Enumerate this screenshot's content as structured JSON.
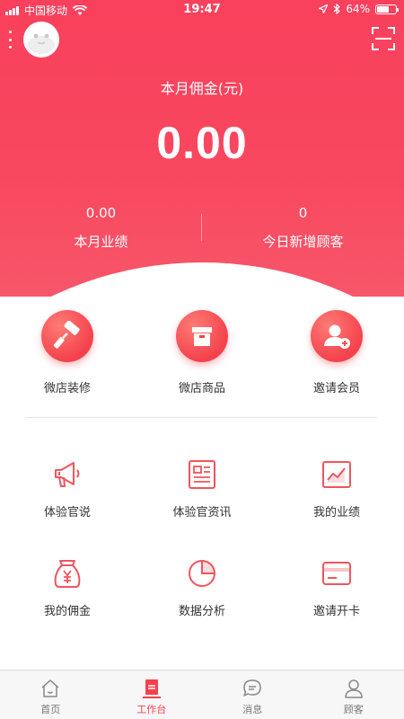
{
  "status_bar": {
    "carrier": "中国移动",
    "time": "19:47",
    "battery": "64%",
    "battery_level": 0.64
  },
  "header": {
    "commission_label": "本月佣金(元)",
    "commission_value": "0.00",
    "stats": [
      {
        "value": "0.00",
        "label": "本月业绩"
      },
      {
        "value": "0",
        "label": "今日新增顾客"
      }
    ]
  },
  "quick_actions": [
    {
      "label": "微店装修",
      "icon": "paint-roller-icon"
    },
    {
      "label": "微店商品",
      "icon": "box-icon"
    },
    {
      "label": "邀请会员",
      "icon": "add-user-icon"
    }
  ],
  "tools": [
    {
      "label": "体验官说",
      "icon": "megaphone-icon"
    },
    {
      "label": "体验官资讯",
      "icon": "news-icon"
    },
    {
      "label": "我的业绩",
      "icon": "trend-chart-icon"
    },
    {
      "label": "我的佣金",
      "icon": "money-bag-icon"
    },
    {
      "label": "数据分析",
      "icon": "pie-chart-icon"
    },
    {
      "label": "邀请开卡",
      "icon": "card-icon"
    }
  ],
  "tabbar": {
    "tabs": [
      {
        "label": "首页",
        "icon": "home-icon",
        "active": false
      },
      {
        "label": "工作台",
        "icon": "workbench-icon",
        "active": true
      },
      {
        "label": "消息",
        "icon": "message-icon",
        "active": false
      },
      {
        "label": "顾客",
        "icon": "customer-icon",
        "active": false
      }
    ]
  },
  "colors": {
    "brand": "#f4424c",
    "header_gradient_top": "#f9405c",
    "text": "#333333"
  }
}
